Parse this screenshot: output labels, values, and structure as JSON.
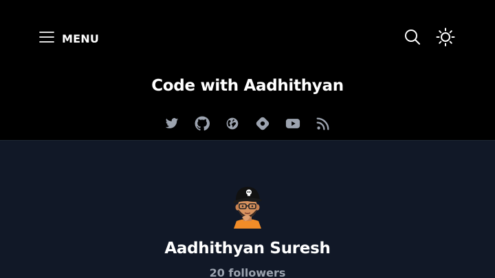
{
  "header": {
    "menu_label": "MENU",
    "blog_title": "Code with Aadhithyan",
    "icons": {
      "menu": "hamburger-icon",
      "search": "search-icon",
      "theme": "sun-icon"
    },
    "socials": [
      {
        "icon": "twitter-icon"
      },
      {
        "icon": "github-icon"
      },
      {
        "icon": "globe-icon"
      },
      {
        "icon": "hashnode-icon"
      },
      {
        "icon": "youtube-icon"
      },
      {
        "icon": "rss-icon"
      }
    ]
  },
  "profile": {
    "name": "Aadhithyan Suresh",
    "followers": "20 followers",
    "avatar": "avatar"
  },
  "colors": {
    "header_bg": "#000000",
    "main_bg": "#111827",
    "text": "#ffffff",
    "muted_text": "#9ca3af",
    "icon_gray": "#9ca3af"
  }
}
